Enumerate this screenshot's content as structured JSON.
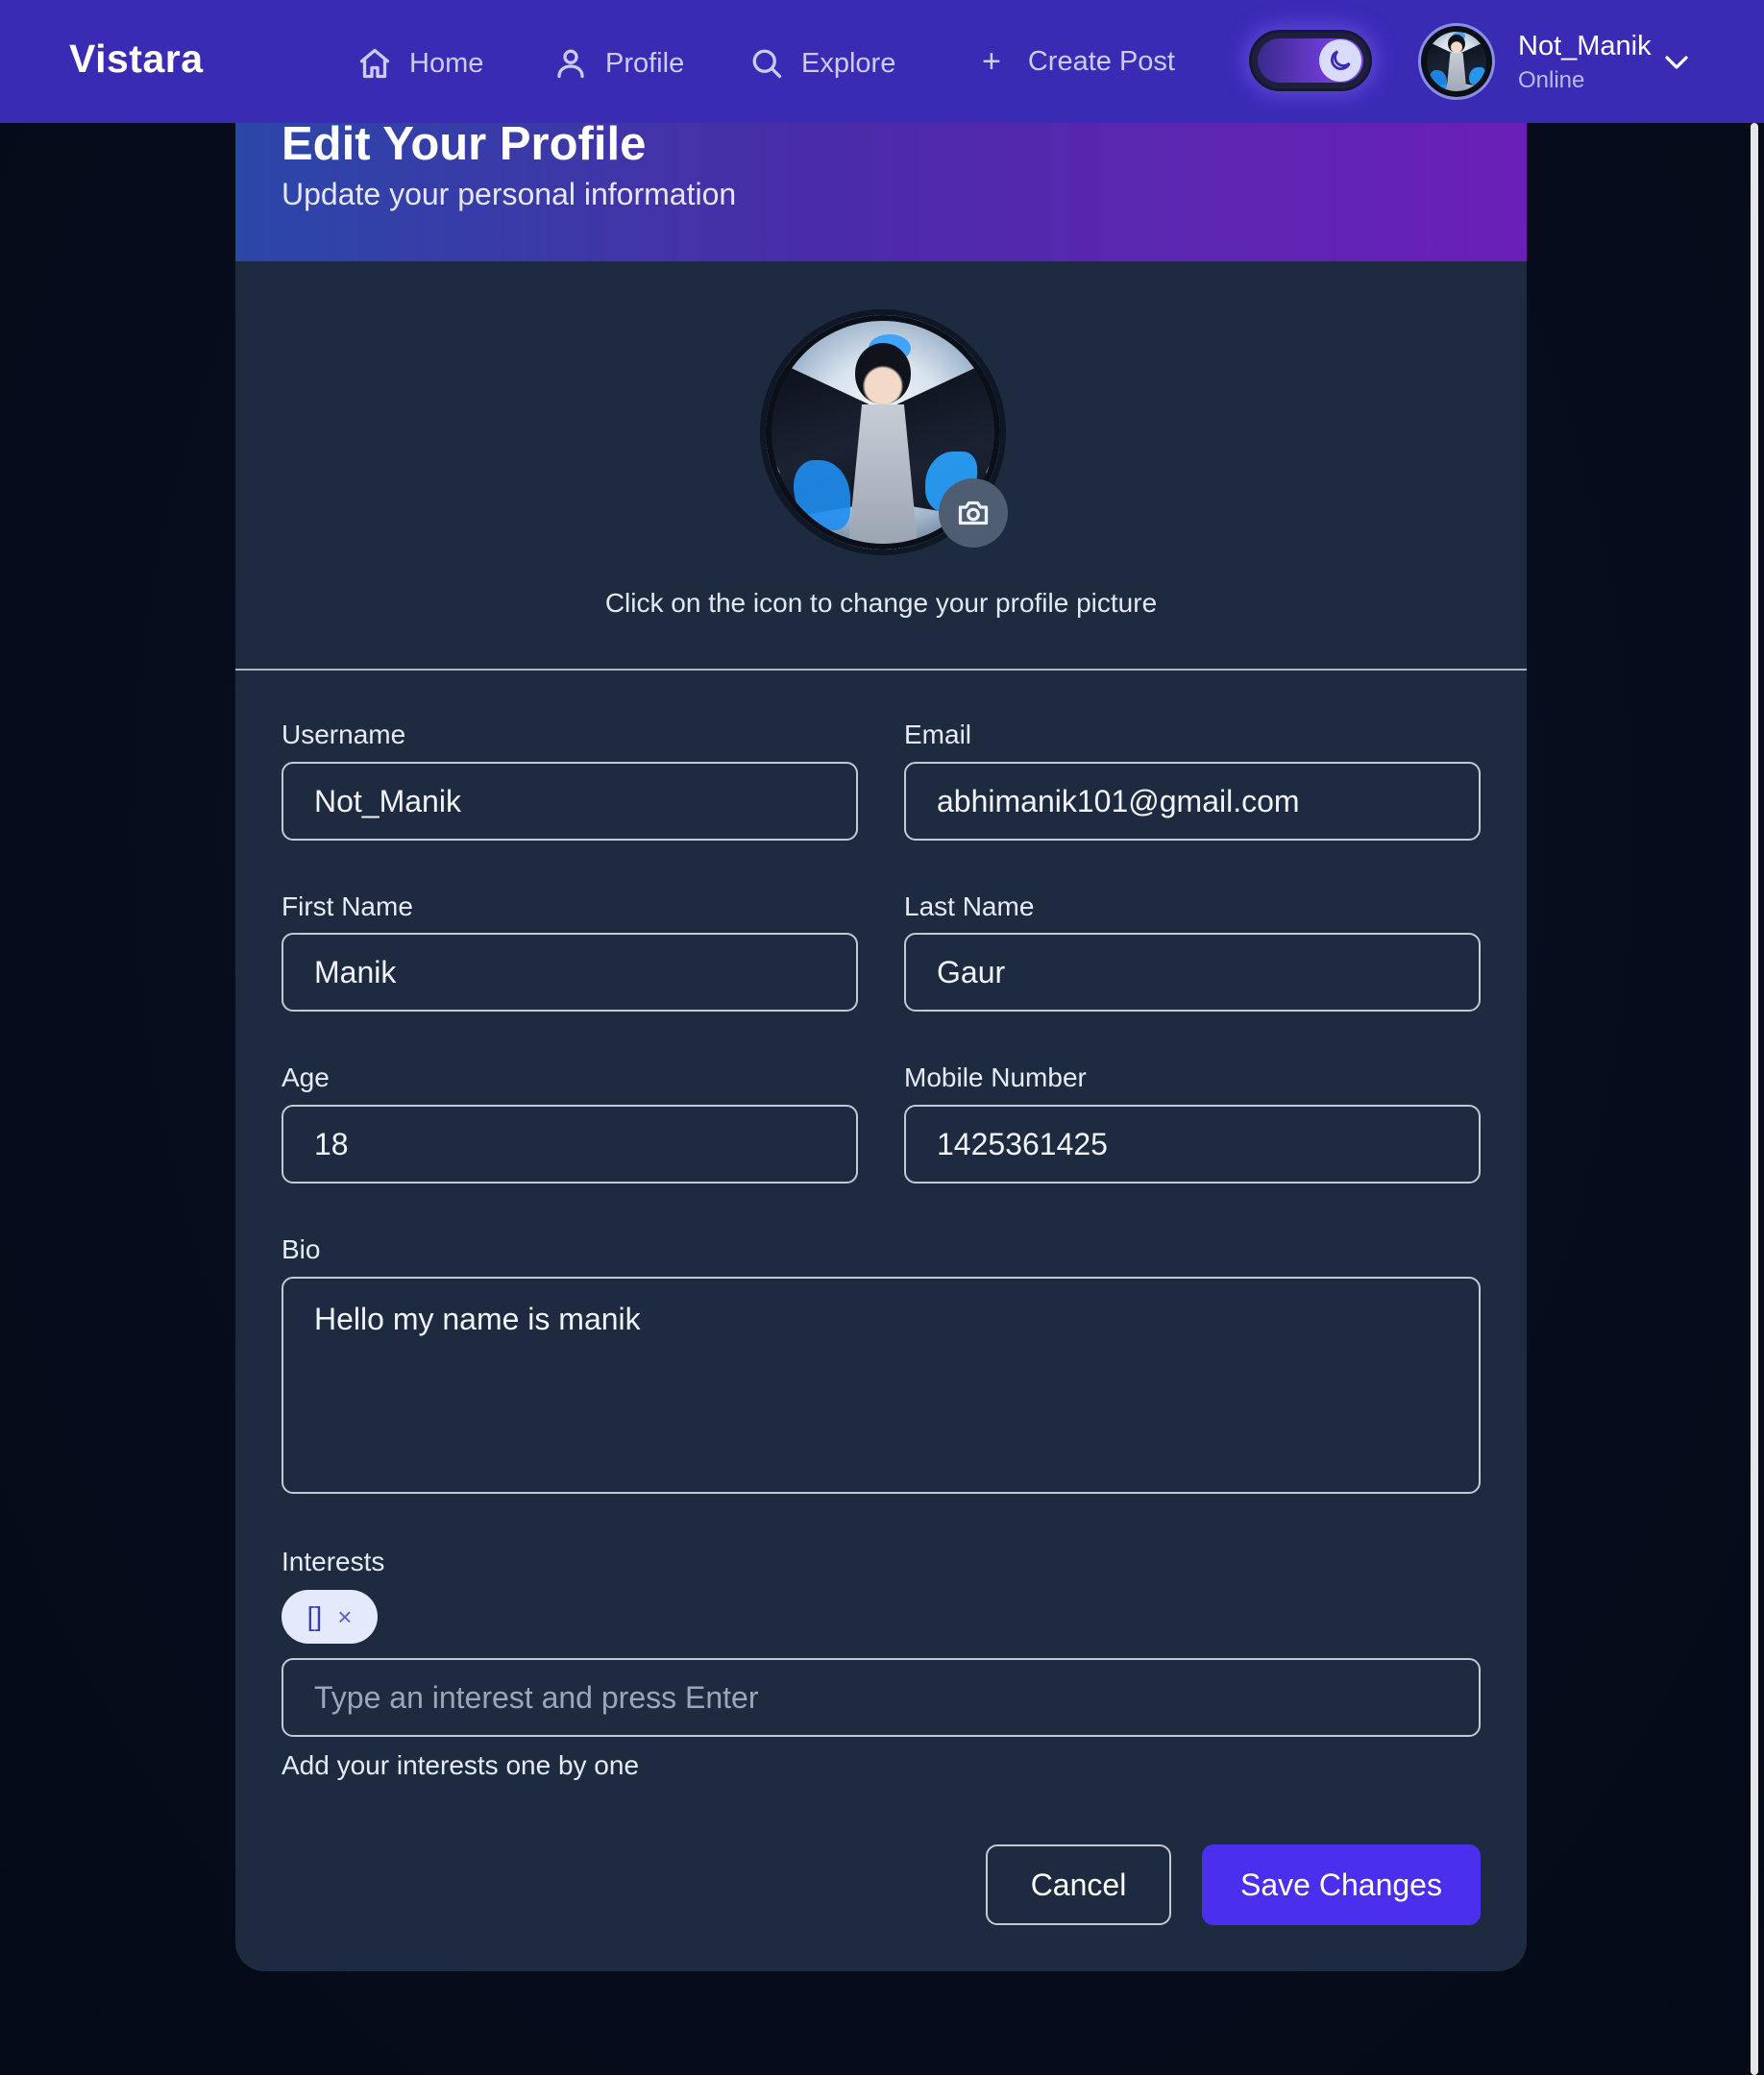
{
  "navbar": {
    "brand": "Vistara",
    "items": [
      {
        "label": "Home",
        "icon": "home-icon"
      },
      {
        "label": "Profile",
        "icon": "user-icon"
      },
      {
        "label": "Explore",
        "icon": "search-icon"
      },
      {
        "label": "Create Post",
        "icon": "plus-icon"
      }
    ],
    "theme_toggle": {
      "mode": "dark",
      "icon": "moon-icon"
    },
    "user": {
      "name": "Not_Manik",
      "status": "Online"
    }
  },
  "profile_form": {
    "title": "Edit Your Profile",
    "subtitle": "Update your personal information",
    "avatar_hint": "Click on the icon to change your profile picture",
    "fields": {
      "username": {
        "label": "Username",
        "value": "Not_Manik"
      },
      "email": {
        "label": "Email",
        "value": "abhimanik101@gmail.com"
      },
      "first_name": {
        "label": "First Name",
        "value": "Manik"
      },
      "last_name": {
        "label": "Last Name",
        "value": "Gaur"
      },
      "age": {
        "label": "Age",
        "value": "18"
      },
      "mobile": {
        "label": "Mobile Number",
        "value": "1425361425"
      },
      "bio": {
        "label": "Bio",
        "value": "Hello my name is manik"
      }
    },
    "interests": {
      "label": "Interests",
      "tags": [
        "[]"
      ],
      "remove_symbol": "×",
      "placeholder": "Type an interest and press Enter",
      "helper": "Add your interests one by one"
    },
    "buttons": {
      "cancel": "Cancel",
      "save": "Save Changes"
    }
  },
  "colors": {
    "navbar_bg": "#3a2bb5",
    "card_bg": "#1d2a3f",
    "primary_button": "#4a30ee",
    "page_bg": "#070d1d"
  }
}
